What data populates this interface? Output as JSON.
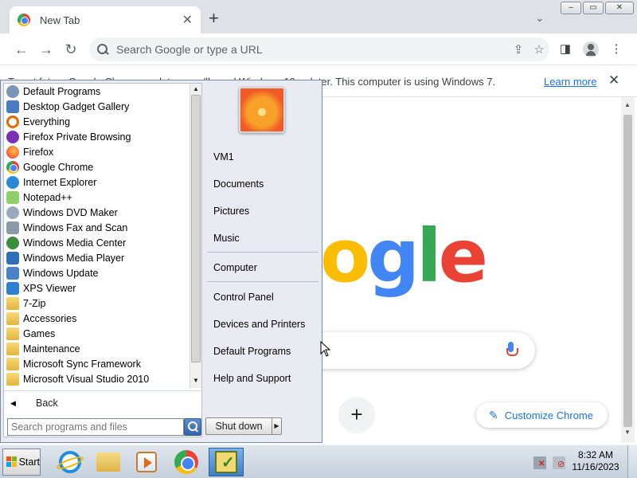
{
  "browser": {
    "tab_title": "New Tab",
    "new_tab_symbol": "+",
    "close_tab_symbol": "✕",
    "omnibox_placeholder": "Search Google or type a URL",
    "infobar_text": "To get future Google Chrome updates, you'll need Windows 10 or later. This computer is using Windows 7.",
    "infobar_link": "Learn more",
    "infobar_close": "✕",
    "customize_label": "Customize Chrome",
    "add_shortcut_symbol": "+",
    "logo_letters": [
      {
        "ch": "o",
        "color": "#fbbc04"
      },
      {
        "ch": "g",
        "color": "#4285f4"
      },
      {
        "ch": "l",
        "color": "#34a853"
      },
      {
        "ch": "e",
        "color": "#ea4335"
      }
    ],
    "icons": [
      "back-icon",
      "forward-icon",
      "reload-icon",
      "share-icon",
      "star-icon",
      "side-panel-icon",
      "profile-icon",
      "menu-icon"
    ]
  },
  "start_menu": {
    "programs": [
      {
        "label": "Default Programs",
        "icon": "ico-gear"
      },
      {
        "label": "Desktop Gadget Gallery",
        "icon": "ico-gadget"
      },
      {
        "label": "Everything",
        "icon": "ico-search"
      },
      {
        "label": "Firefox Private Browsing",
        "icon": "ico-ffp"
      },
      {
        "label": "Firefox",
        "icon": "ico-firefox"
      },
      {
        "label": "Google Chrome",
        "icon": "ico-chrome"
      },
      {
        "label": "Internet Explorer",
        "icon": "ico-ie"
      },
      {
        "label": "Notepad++",
        "icon": "ico-note"
      },
      {
        "label": "Windows DVD Maker",
        "icon": "ico-dvd"
      },
      {
        "label": "Windows Fax and Scan",
        "icon": "ico-fax"
      },
      {
        "label": "Windows Media Center",
        "icon": "ico-wmc"
      },
      {
        "label": "Windows Media Player",
        "icon": "ico-wmp"
      },
      {
        "label": "Windows Update",
        "icon": "ico-update"
      },
      {
        "label": "XPS Viewer",
        "icon": "ico-xps"
      },
      {
        "label": "7-Zip",
        "icon": "ico-folder"
      },
      {
        "label": "Accessories",
        "icon": "ico-folder"
      },
      {
        "label": "Games",
        "icon": "ico-folder"
      },
      {
        "label": "Maintenance",
        "icon": "ico-folder"
      },
      {
        "label": "Microsoft Sync Framework",
        "icon": "ico-folder"
      },
      {
        "label": "Microsoft Visual Studio 2010",
        "icon": "ico-folder"
      }
    ],
    "back_label": "Back",
    "search_placeholder": "Search programs and files",
    "user_name": "VM1",
    "right_items": {
      "documents": "Documents",
      "pictures": "Pictures",
      "music": "Music",
      "computer": "Computer",
      "control_panel": "Control Panel",
      "devices_printers": "Devices and Printers",
      "default_programs": "Default Programs",
      "help_support": "Help and Support"
    },
    "shutdown_label": "Shut down"
  },
  "taskbar": {
    "start_label": "Start",
    "apps": [
      "internet-explorer",
      "windows-explorer",
      "windows-media-player",
      "google-chrome",
      "checklist-app"
    ],
    "active_app": "checklist-app",
    "clock_time": "8:32 AM",
    "clock_date": "11/16/2023"
  }
}
